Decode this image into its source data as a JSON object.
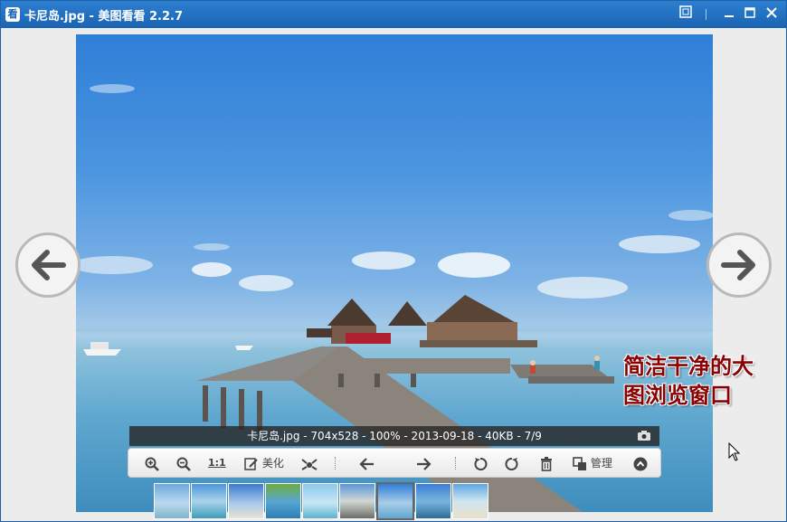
{
  "window": {
    "title": "卡尼岛.jpg - 美图看看 2.2.7",
    "app_icon_glyph": "看"
  },
  "titlebar_buttons": {
    "fullscreen_icon": "fullscreen-icon",
    "minimize_icon": "minimize-icon",
    "maximize_icon": "maximize-icon",
    "close_icon": "close-icon"
  },
  "image_info": "卡尼岛.jpg - 704x528 - 100% - 2013-09-18 - 40KB - 7/9",
  "overlay_text": {
    "line1": "简洁干净的大",
    "line2": "图浏览窗口"
  },
  "toolbar": {
    "one_to_one": "1:1",
    "beautify": "美化",
    "manage": "管理"
  },
  "thumbnails": {
    "count": 9,
    "active_index": 6
  },
  "colors": {
    "titlebar": "#1a64b3",
    "overlay_text": "#8b0000"
  }
}
